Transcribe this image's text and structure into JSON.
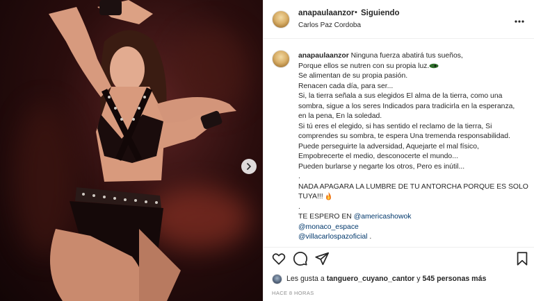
{
  "post": {
    "username": "anapaulaanzor",
    "separator": "•",
    "follow_status": "Siguiendo",
    "location": "Carlos Paz Cordoba",
    "more_icon": "more-horizontal-icon"
  },
  "caption": {
    "username": "anapaulaanzor",
    "lines": [
      "Ninguna fuerza abatirá tus sueños,",
      "Porque ellos se nutren con su propia luz.",
      "Se alimentan de su propia pasión.",
      "Renacen cada día, para ser...",
      "Si, la tierra señala a sus elegidos El alma de la tierra, como una",
      "sombra, sigue a los seres Indicados para tradicirla en la esperanza,",
      "en la pena, En la soledad.",
      "Si tú eres el elegido, si has sentido el reclamo de la tierra, Si",
      "comprendes su sombra, te espera Una tremenda responsabilidad.",
      "Puede perseguirte la adversidad, Aquejarte el mal físico,",
      "Empobrecerte el medio, desconocerte el mundo...",
      "Pueden burlarse y negarte los otros, Pero es inútil...",
      ".",
      "NADA APAGARA LA LUMBRE DE TU ANTORCHA PORQUE ES SOLO",
      "TUYA!!!",
      ".",
      "TE ESPERO EN"
    ],
    "mentions": [
      "@americashowok",
      "@monaco_espace",
      "@villacarlospazoficial"
    ],
    "trailing_dot": "."
  },
  "actions": {
    "like_icon": "heart-icon",
    "comment_icon": "comment-icon",
    "share_icon": "send-icon",
    "save_icon": "bookmark-icon"
  },
  "likes": {
    "prefix": "Les gusta a",
    "user": "tanguero_cuyano_cantor",
    "connector": "y",
    "others": "545 personas más"
  },
  "timestamp": "HACE 8 HORAS",
  "media": {
    "next_icon": "chevron-right-icon"
  },
  "colors": {
    "link": "#00376b",
    "text": "#262626",
    "muted": "#8e8e8e",
    "divider": "#efefef"
  }
}
